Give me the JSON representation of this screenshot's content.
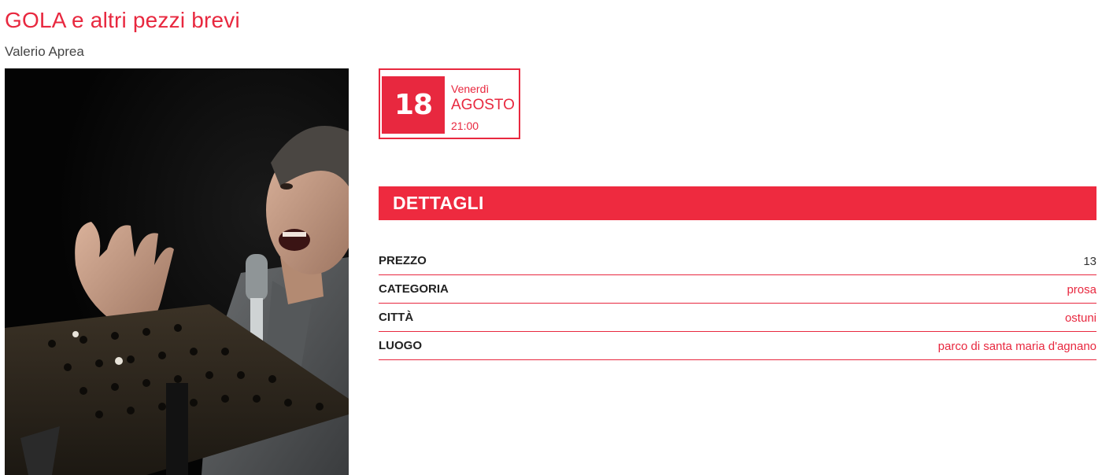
{
  "event": {
    "title": "GOLA e altri pezzi brevi",
    "author": "Valerio Aprea"
  },
  "date": {
    "day": "18",
    "weekday": "Venerdì",
    "month": "AGOSTO",
    "time": "21:00"
  },
  "details": {
    "heading": "DETTAGLI",
    "rows": [
      {
        "label": "PREZZO",
        "value": "13"
      },
      {
        "label": "CATEGORIA",
        "value": "prosa"
      },
      {
        "label": "CITTÀ",
        "value": "ostuni"
      },
      {
        "label": "LUOGO",
        "value": "parco di santa maria d'agnano"
      }
    ]
  },
  "colors": {
    "accent": "#e8283f",
    "header_bg": "#ee2a3f"
  },
  "photo": {
    "subject": "performer-with-microphone-icon"
  }
}
